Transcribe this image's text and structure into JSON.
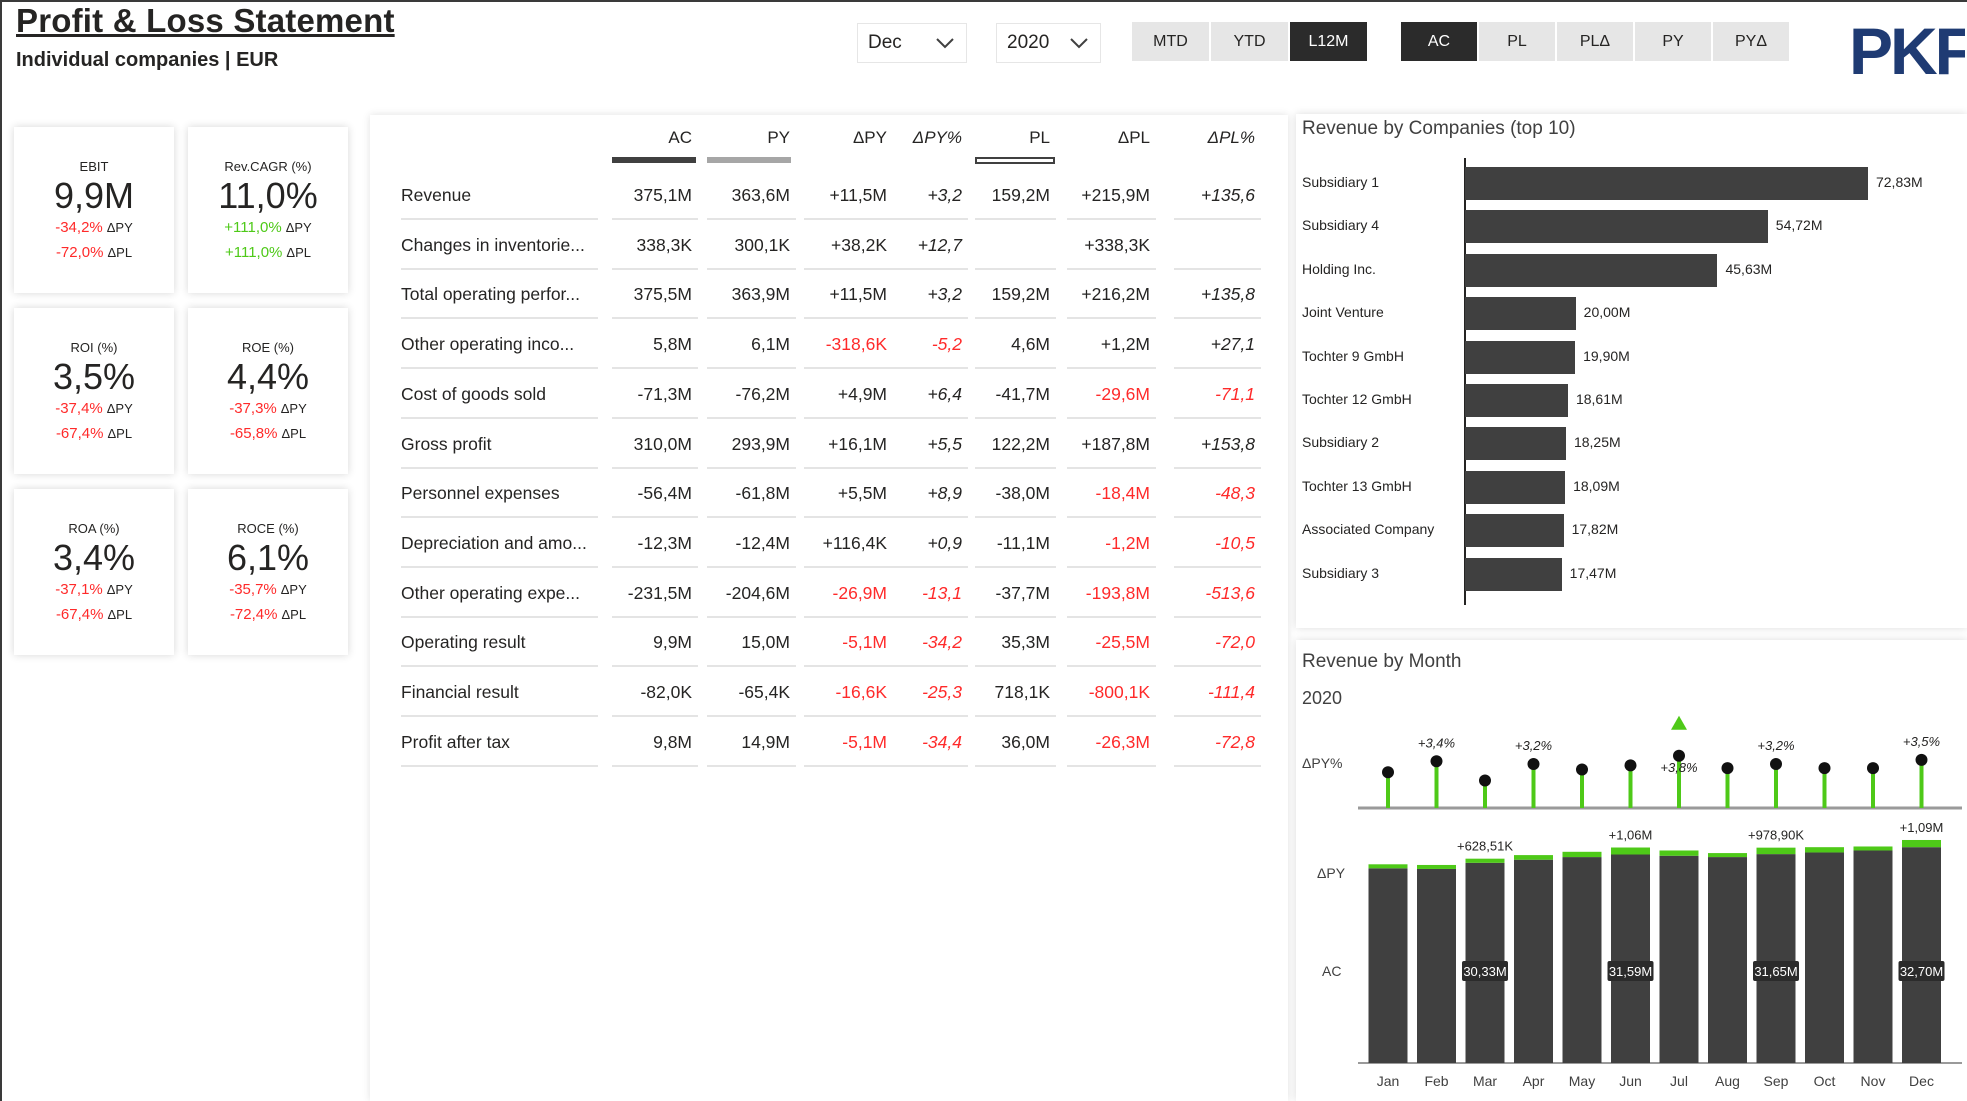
{
  "header": {
    "title": "Profit & Loss Statement",
    "subtitle": "Individual companies | EUR",
    "month_select": "Dec",
    "year_select": "2020",
    "period_buttons": [
      {
        "label": "MTD",
        "active": false
      },
      {
        "label": "YTD",
        "active": false
      },
      {
        "label": "L12M",
        "active": true
      }
    ],
    "scenario_buttons": [
      {
        "label": "AC",
        "active": true
      },
      {
        "label": "PL",
        "active": false
      },
      {
        "label": "PLΔ",
        "active": false
      },
      {
        "label": "PY",
        "active": false
      },
      {
        "label": "PYΔ",
        "active": false
      }
    ],
    "logo_text": "PKF",
    "colors": {
      "dark": "#2b2b2b",
      "button_bg": "#e6e6e6",
      "negative": "#ff2a2a",
      "positive": "#4ec918",
      "logo": "#1f3b73"
    }
  },
  "kpis": [
    {
      "label": "EBIT",
      "value": "9,9M",
      "py": "-34,2%",
      "py_sign": "neg",
      "pl": "-72,0%",
      "pl_sign": "neg",
      "py_tag": "ΔPY",
      "pl_tag": "ΔPL"
    },
    {
      "label": "Rev.CAGR (%)",
      "value": "11,0%",
      "py": "+111,0%",
      "py_sign": "pos",
      "pl": "+111,0%",
      "pl_sign": "pos",
      "py_tag": "ΔPY",
      "pl_tag": "ΔPL"
    },
    {
      "label": "ROI (%)",
      "value": "3,5%",
      "py": "-37,4%",
      "py_sign": "neg",
      "pl": "-67,4%",
      "pl_sign": "neg",
      "py_tag": "ΔPY",
      "pl_tag": "ΔPL"
    },
    {
      "label": "ROE (%)",
      "value": "4,4%",
      "py": "-37,3%",
      "py_sign": "neg",
      "pl": "-65,8%",
      "pl_sign": "neg",
      "py_tag": "ΔPY",
      "pl_tag": "ΔPL"
    },
    {
      "label": "ROA (%)",
      "value": "3,4%",
      "py": "-37,1%",
      "py_sign": "neg",
      "pl": "-67,4%",
      "pl_sign": "neg",
      "py_tag": "ΔPY",
      "pl_tag": "ΔPL"
    },
    {
      "label": "ROCE (%)",
      "value": "6,1%",
      "py": "-35,7%",
      "py_sign": "neg",
      "pl": "-72,4%",
      "pl_sign": "neg",
      "py_tag": "ΔPY",
      "pl_tag": "ΔPL"
    }
  ],
  "table": {
    "columns": [
      "AC",
      "PY",
      "ΔPY",
      "ΔPY%",
      "PL",
      "ΔPL",
      "ΔPL%"
    ],
    "rows": [
      {
        "label": "Revenue",
        "cells": [
          "375,1M",
          "363,6M",
          "+11,5M",
          "+3,2",
          "159,2M",
          "+215,9M",
          "+135,6"
        ],
        "neg": [
          false,
          false,
          false,
          false,
          false,
          false,
          false
        ]
      },
      {
        "label": "Changes in inventorie...",
        "cells": [
          "338,3K",
          "300,1K",
          "+38,2K",
          "+12,7",
          "",
          "+338,3K",
          ""
        ],
        "neg": [
          false,
          false,
          false,
          false,
          false,
          false,
          false
        ]
      },
      {
        "label": "Total operating perfor...",
        "cells": [
          "375,5M",
          "363,9M",
          "+11,5M",
          "+3,2",
          "159,2M",
          "+216,2M",
          "+135,8"
        ],
        "neg": [
          false,
          false,
          false,
          false,
          false,
          false,
          false
        ]
      },
      {
        "label": "Other operating inco...",
        "cells": [
          "5,8M",
          "6,1M",
          "-318,6K",
          "-5,2",
          "4,6M",
          "+1,2M",
          "+27,1"
        ],
        "neg": [
          false,
          false,
          true,
          true,
          false,
          false,
          false
        ]
      },
      {
        "label": "Cost of goods sold",
        "cells": [
          "-71,3M",
          "-76,2M",
          "+4,9M",
          "+6,4",
          "-41,7M",
          "-29,6M",
          "-71,1"
        ],
        "neg": [
          false,
          false,
          false,
          false,
          false,
          true,
          true
        ]
      },
      {
        "label": "Gross profit",
        "cells": [
          "310,0M",
          "293,9M",
          "+16,1M",
          "+5,5",
          "122,2M",
          "+187,8M",
          "+153,8"
        ],
        "neg": [
          false,
          false,
          false,
          false,
          false,
          false,
          false
        ]
      },
      {
        "label": "Personnel expenses",
        "cells": [
          "-56,4M",
          "-61,8M",
          "+5,5M",
          "+8,9",
          "-38,0M",
          "-18,4M",
          "-48,3"
        ],
        "neg": [
          false,
          false,
          false,
          false,
          false,
          true,
          true
        ]
      },
      {
        "label": "Depreciation and amo...",
        "cells": [
          "-12,3M",
          "-12,4M",
          "+116,4K",
          "+0,9",
          "-11,1M",
          "-1,2M",
          "-10,5"
        ],
        "neg": [
          false,
          false,
          false,
          false,
          false,
          true,
          true
        ]
      },
      {
        "label": "Other operating expe...",
        "cells": [
          "-231,5M",
          "-204,6M",
          "-26,9M",
          "-13,1",
          "-37,7M",
          "-193,8M",
          "-513,6"
        ],
        "neg": [
          false,
          false,
          true,
          true,
          false,
          true,
          true
        ]
      },
      {
        "label": "Operating result",
        "cells": [
          "9,9M",
          "15,0M",
          "-5,1M",
          "-34,2",
          "35,3M",
          "-25,5M",
          "-72,0"
        ],
        "neg": [
          false,
          false,
          true,
          true,
          false,
          true,
          true
        ]
      },
      {
        "label": "Financial result",
        "cells": [
          "-82,0K",
          "-65,4K",
          "-16,6K",
          "-25,3",
          "718,1K",
          "-800,1K",
          "-111,4"
        ],
        "neg": [
          false,
          false,
          true,
          true,
          false,
          true,
          true
        ]
      },
      {
        "label": "Profit after tax",
        "cells": [
          "9,8M",
          "14,9M",
          "-5,1M",
          "-34,4",
          "36,0M",
          "-26,3M",
          "-72,8"
        ],
        "neg": [
          false,
          false,
          true,
          true,
          false,
          true,
          true
        ]
      }
    ]
  },
  "chart_data": [
    {
      "type": "bar",
      "orientation": "horizontal",
      "title": "Revenue by Companies (top 10)",
      "categories": [
        "Subsidiary 1",
        "Subsidiary 4",
        "Holding Inc.",
        "Joint Venture",
        "Tochter 9 GmbH",
        "Tochter 12 GmbH",
        "Subsidiary 2",
        "Tochter 13 GmbH",
        "Associated Company",
        "Subsidiary 3"
      ],
      "values": [
        72.83,
        54.72,
        45.63,
        20.0,
        19.9,
        18.61,
        18.25,
        18.09,
        17.82,
        17.47
      ],
      "value_labels": [
        "72,83M",
        "54,72M",
        "45,63M",
        "20,00M",
        "19,90M",
        "18,61M",
        "18,25M",
        "18,09M",
        "17,82M",
        "17,47M"
      ],
      "xlim": [
        0,
        75
      ],
      "colors": {
        "bar": "#404040"
      }
    },
    {
      "type": "bar",
      "title": "Revenue by Month",
      "subtitle": "2020",
      "row_labels": {
        "pct": "ΔPY%",
        "delta": "ΔPY",
        "ac": "AC"
      },
      "categories": [
        "Jan",
        "Feb",
        "Mar",
        "Apr",
        "May",
        "Jun",
        "Jul",
        "Aug",
        "Sep",
        "Oct",
        "Nov",
        "Dec"
      ],
      "ac": [
        29.5,
        29.4,
        30.33,
        30.8,
        31.2,
        31.59,
        31.4,
        31.2,
        31.65,
        31.9,
        32.2,
        32.7
      ],
      "delta_py": [
        0.5,
        0.6,
        0.62851,
        0.7,
        0.8,
        1.06,
        0.8,
        0.5,
        0.9789,
        0.8,
        0.6,
        1.09
      ],
      "pct_py": [
        2.6,
        3.4,
        2.0,
        3.2,
        2.8,
        3.1,
        3.8,
        2.9,
        3.2,
        2.9,
        2.9,
        3.5
      ],
      "pct_labels": [
        "",
        "+3,4%",
        "",
        "+3,2%",
        "",
        "",
        "+3,8%",
        "",
        "+3,2%",
        "",
        "",
        "+3,5%"
      ],
      "delta_labels": [
        "",
        "",
        "+628,51K",
        "",
        "",
        "+1,06M",
        "",
        "",
        "+978,90K",
        "",
        "",
        "+1,09M"
      ],
      "ac_labels": [
        "",
        "",
        "30,33M",
        "",
        "",
        "31,59M",
        "",
        "",
        "31,65M",
        "",
        "",
        "32,70M"
      ],
      "highlight_month": "Jul",
      "colors": {
        "ac": "#404040",
        "positive": "#4ec918",
        "axis": "#9a9a9a"
      }
    }
  ]
}
